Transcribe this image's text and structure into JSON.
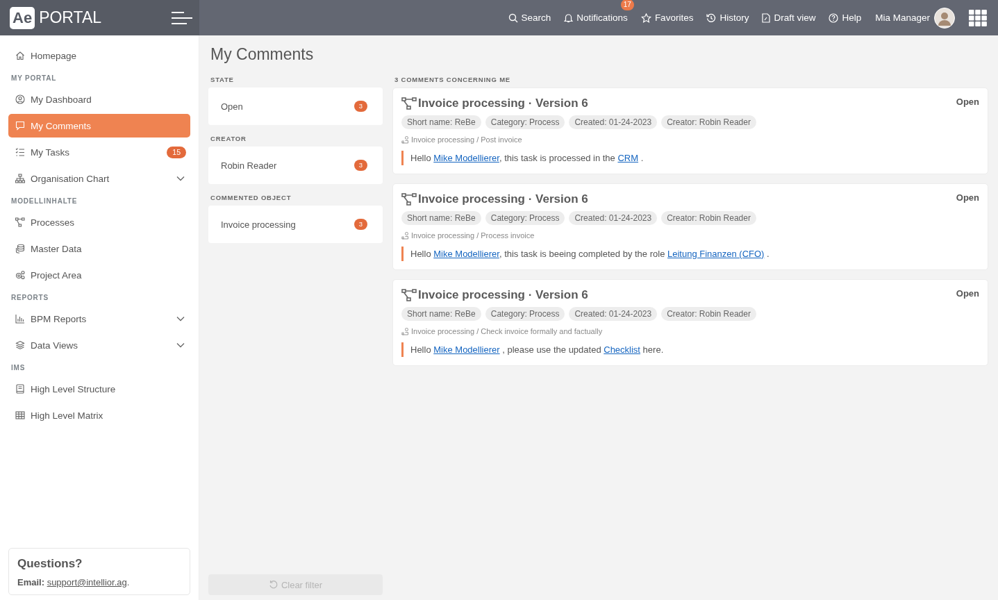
{
  "header": {
    "logo_mark": "Ae",
    "logo_text": "PORTAL",
    "nav": [
      {
        "label": "Search"
      },
      {
        "label": "Notifications",
        "badge": "17"
      },
      {
        "label": "Favorites"
      },
      {
        "label": "History"
      },
      {
        "label": "Draft view"
      },
      {
        "label": "Help"
      }
    ],
    "user": "Mia Manager"
  },
  "sidebar": {
    "items": [
      {
        "kind": "item",
        "label": "Homepage",
        "selected": false,
        "expandable": false
      },
      {
        "kind": "heading",
        "label": "MY PORTAL"
      },
      {
        "kind": "item",
        "label": "My Dashboard",
        "selected": false,
        "expandable": false
      },
      {
        "kind": "item",
        "label": "My Comments",
        "selected": true,
        "expandable": false
      },
      {
        "kind": "item",
        "label": "My Tasks",
        "selected": false,
        "expandable": false,
        "badge": "15"
      },
      {
        "kind": "item",
        "label": "Organisation Chart",
        "selected": false,
        "expandable": true
      },
      {
        "kind": "heading",
        "label": "MODELLINHALTE"
      },
      {
        "kind": "item",
        "label": "Processes",
        "selected": false,
        "expandable": false
      },
      {
        "kind": "item",
        "label": "Master Data",
        "selected": false,
        "expandable": false
      },
      {
        "kind": "item",
        "label": "Project Area",
        "selected": false,
        "expandable": false
      },
      {
        "kind": "heading",
        "label": "REPORTS"
      },
      {
        "kind": "item",
        "label": "BPM Reports",
        "selected": false,
        "expandable": true
      },
      {
        "kind": "item",
        "label": "Data Views",
        "selected": false,
        "expandable": true
      },
      {
        "kind": "heading",
        "label": "IMS"
      },
      {
        "kind": "item",
        "label": "High Level Structure",
        "selected": false,
        "expandable": false
      },
      {
        "kind": "item",
        "label": "High Level Matrix",
        "selected": false,
        "expandable": false
      }
    ],
    "help": {
      "title": "Questions?",
      "label": "Email:",
      "link": "support@intellior.ag",
      "trail": "."
    }
  },
  "page_title": "My Comments",
  "filters": [
    {
      "heading": "STATE",
      "items": [
        {
          "label": "Open",
          "count": "3"
        }
      ]
    },
    {
      "heading": "CREATOR",
      "items": [
        {
          "label": "Robin Reader",
          "count": "3"
        }
      ]
    },
    {
      "heading": "COMMENTED OBJECT",
      "items": [
        {
          "label": "Invoice processing",
          "count": "3"
        }
      ]
    }
  ],
  "clear_filter": {
    "label": "Clear filter",
    "disabled": true
  },
  "comments_heading": "3 COMMENTS CONCERNING ME",
  "comments": [
    {
      "title": "Invoice processing · Version 6",
      "status": "Open",
      "tags": [
        "Short name: ReBe",
        "Category: Process",
        "Created: 01-24-2023",
        "Creator: Robin Reader"
      ],
      "path": "Invoice processing / Post invoice",
      "message": [
        {
          "kind": "text",
          "text": "Hello "
        },
        {
          "kind": "link",
          "text": "Mike Modellierer"
        },
        {
          "kind": "text",
          "text": ", this task is processed in the "
        },
        {
          "kind": "link",
          "text": "CRM"
        },
        {
          "kind": "text",
          "text": " ."
        }
      ]
    },
    {
      "title": "Invoice processing · Version 6",
      "status": "Open",
      "tags": [
        "Short name: ReBe",
        "Category: Process",
        "Created: 01-24-2023",
        "Creator: Robin Reader"
      ],
      "path": "Invoice processing / Process invoice",
      "message": [
        {
          "kind": "text",
          "text": "Hello "
        },
        {
          "kind": "link",
          "text": "Mike Modellierer"
        },
        {
          "kind": "text",
          "text": ", this task is beeing completed by the role "
        },
        {
          "kind": "link",
          "text": "Leitung Finanzen (CFO)"
        },
        {
          "kind": "text",
          "text": " ."
        }
      ]
    },
    {
      "title": "Invoice processing · Version 6",
      "status": "Open",
      "tags": [
        "Short name: ReBe",
        "Category: Process",
        "Created: 01-24-2023",
        "Creator: Robin Reader"
      ],
      "path": "Invoice processing / Check invoice formally and factually",
      "message": [
        {
          "kind": "text",
          "text": "Hello "
        },
        {
          "kind": "link",
          "text": "Mike Modellierer"
        },
        {
          "kind": "text",
          "text": " , please use the updated "
        },
        {
          "kind": "link",
          "text": "Checklist"
        },
        {
          "kind": "text",
          "text": " here."
        }
      ]
    }
  ]
}
